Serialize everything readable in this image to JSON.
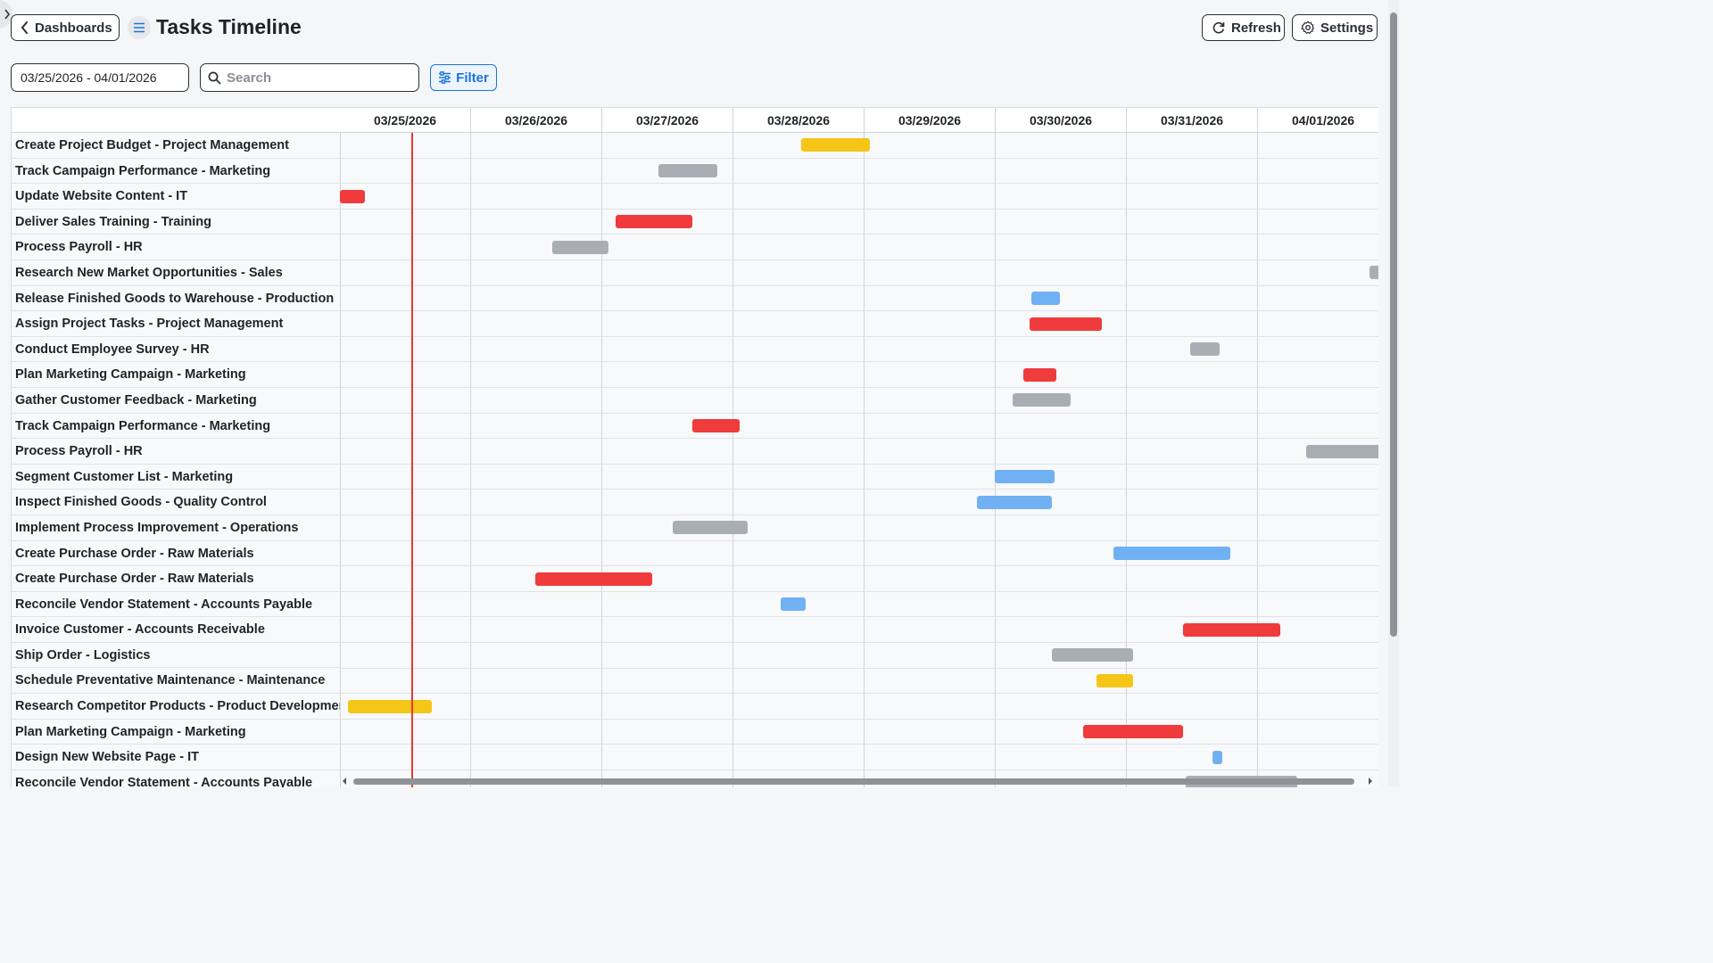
{
  "header": {
    "back_label": "Dashboards",
    "title": "Tasks Timeline",
    "refresh_label": "Refresh",
    "settings_label": "Settings"
  },
  "toolbar": {
    "date_range": "03/25/2026 - 04/01/2026",
    "search_placeholder": "Search",
    "filter_label": "Filter"
  },
  "timeline": {
    "days": [
      "03/25/2026",
      "03/26/2026",
      "03/27/2026",
      "03/28/2026",
      "03/29/2026",
      "03/30/2026",
      "03/31/2026",
      "04/01/2026"
    ],
    "today_offset_days": 0.55
  },
  "colors": {
    "red": "#ef3b3b",
    "gray": "#a9aeb4",
    "blue": "#6fb1f2",
    "yellow": "#f5c518",
    "today_line": "#e53935",
    "accent": "#1a73d9"
  },
  "tasks": [
    {
      "label": "Create Project Budget - Project Management",
      "start": 3.52,
      "end": 4.04,
      "color": "yellow"
    },
    {
      "label": "Track Campaign Performance - Marketing",
      "start": 2.43,
      "end": 2.88,
      "color": "gray"
    },
    {
      "label": "Update Website Content - IT",
      "start": 0.0,
      "end": 0.19,
      "color": "red"
    },
    {
      "label": "Deliver Sales Training - Training",
      "start": 2.1,
      "end": 2.69,
      "color": "red"
    },
    {
      "label": "Process Payroll - HR",
      "start": 1.62,
      "end": 2.05,
      "color": "gray"
    },
    {
      "label": "Research New Market Opportunities - Sales",
      "start": 7.85,
      "end": 8.2,
      "color": "gray"
    },
    {
      "label": "Release Finished Goods to Warehouse - Production",
      "start": 5.27,
      "end": 5.49,
      "color": "blue"
    },
    {
      "label": "Assign Project Tasks - Project Management",
      "start": 5.26,
      "end": 5.81,
      "color": "red"
    },
    {
      "label": "Conduct Employee Survey - HR",
      "start": 6.48,
      "end": 6.71,
      "color": "gray"
    },
    {
      "label": "Plan Marketing Campaign - Marketing",
      "start": 5.21,
      "end": 5.46,
      "color": "red"
    },
    {
      "label": "Gather Customer Feedback - Marketing",
      "start": 5.13,
      "end": 5.57,
      "color": "gray"
    },
    {
      "label": "Track Campaign Performance - Marketing",
      "start": 2.69,
      "end": 3.05,
      "color": "red"
    },
    {
      "label": "Process Payroll - HR",
      "start": 7.37,
      "end": 8.2,
      "color": "gray"
    },
    {
      "label": "Segment Customer List - Marketing",
      "start": 4.99,
      "end": 5.45,
      "color": "blue"
    },
    {
      "label": "Inspect Finished Goods - Quality Control",
      "start": 4.86,
      "end": 5.43,
      "color": "blue"
    },
    {
      "label": "Implement Process Improvement - Operations",
      "start": 2.54,
      "end": 3.11,
      "color": "gray"
    },
    {
      "label": "Create Purchase Order - Raw Materials",
      "start": 5.9,
      "end": 6.79,
      "color": "blue"
    },
    {
      "label": "Create Purchase Order - Raw Materials",
      "start": 1.49,
      "end": 2.38,
      "color": "red"
    },
    {
      "label": "Reconcile Vendor Statement - Accounts Payable",
      "start": 3.36,
      "end": 3.55,
      "color": "blue"
    },
    {
      "label": "Invoice Customer - Accounts Receivable",
      "start": 6.43,
      "end": 7.17,
      "color": "red"
    },
    {
      "label": "Ship Order - Logistics",
      "start": 5.43,
      "end": 6.05,
      "color": "gray"
    },
    {
      "label": "Schedule Preventative Maintenance - Maintenance",
      "start": 5.77,
      "end": 6.05,
      "color": "yellow"
    },
    {
      "label": "Research Competitor Products - Product Development",
      "start": 0.06,
      "end": 0.7,
      "color": "yellow"
    },
    {
      "label": "Plan Marketing Campaign - Marketing",
      "start": 5.67,
      "end": 6.43,
      "color": "red"
    },
    {
      "label": "Design New Website Page - IT",
      "start": 6.65,
      "end": 6.73,
      "color": "blue"
    },
    {
      "label": "Reconcile Vendor Statement - Accounts Payable",
      "start": 6.45,
      "end": 7.3,
      "color": "gray"
    }
  ]
}
